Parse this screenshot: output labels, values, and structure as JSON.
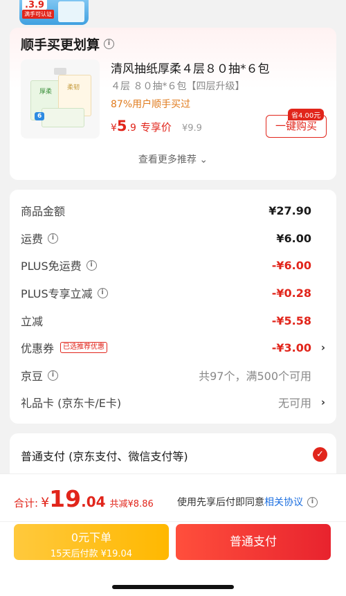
{
  "prev_item": {
    "price_tag": ".3.9",
    "badge": "满手可认证"
  },
  "recommend": {
    "title": "顺手买更划算",
    "product": {
      "name": "清风抽纸厚柔４层８０抽*６包",
      "spec": "４层 ８０抽*６包【四层升级】",
      "rate": "87%用户顺手买过",
      "price_symbol": "¥",
      "price_int": "5",
      "price_dec": ".9",
      "price_label": "专享价",
      "orig_price": "¥9.9",
      "save_badge": "省4.00元",
      "buy_label": "一键购买",
      "img_mark": "6",
      "img_text_a": "厚柔",
      "img_text_b": "柔韧"
    },
    "more_label": "查看更多推荐 ⌄"
  },
  "summary": {
    "rows": [
      {
        "label": "商品金额",
        "value": "¥27.90"
      },
      {
        "label": "运费",
        "value": "¥6.00"
      },
      {
        "label": "PLUS免运费",
        "value": "-¥6.00"
      },
      {
        "label": "PLUS专享立减",
        "value": "-¥0.28"
      },
      {
        "label": "立减",
        "value": "-¥5.58"
      },
      {
        "label": "优惠券",
        "tag": "已选推荐优惠",
        "value": "-¥3.00"
      },
      {
        "label": "京豆",
        "value": "共97个，满500个可用"
      },
      {
        "label": "礼品卡 (京东卡/E卡)",
        "value": "无可用"
      }
    ]
  },
  "payment": {
    "method": "普通支付 (京东支付、微信支付等)"
  },
  "footer": {
    "total_label": "合计:",
    "total_symbol": "¥",
    "total_int": "19",
    "total_dec": ".04",
    "total_saving": "共减¥8.86",
    "agree_text": "使用先享后付即同意",
    "agree_link": "相关协议",
    "btn_later_line1": "0元下单",
    "btn_later_line2": "15天后付款 ¥19.04",
    "btn_pay": "普通支付"
  },
  "colors": {
    "accent": "#e1251b",
    "link": "#1c6fe0",
    "orange": "#e07b1e",
    "yellow_btn": "#ffb800"
  }
}
